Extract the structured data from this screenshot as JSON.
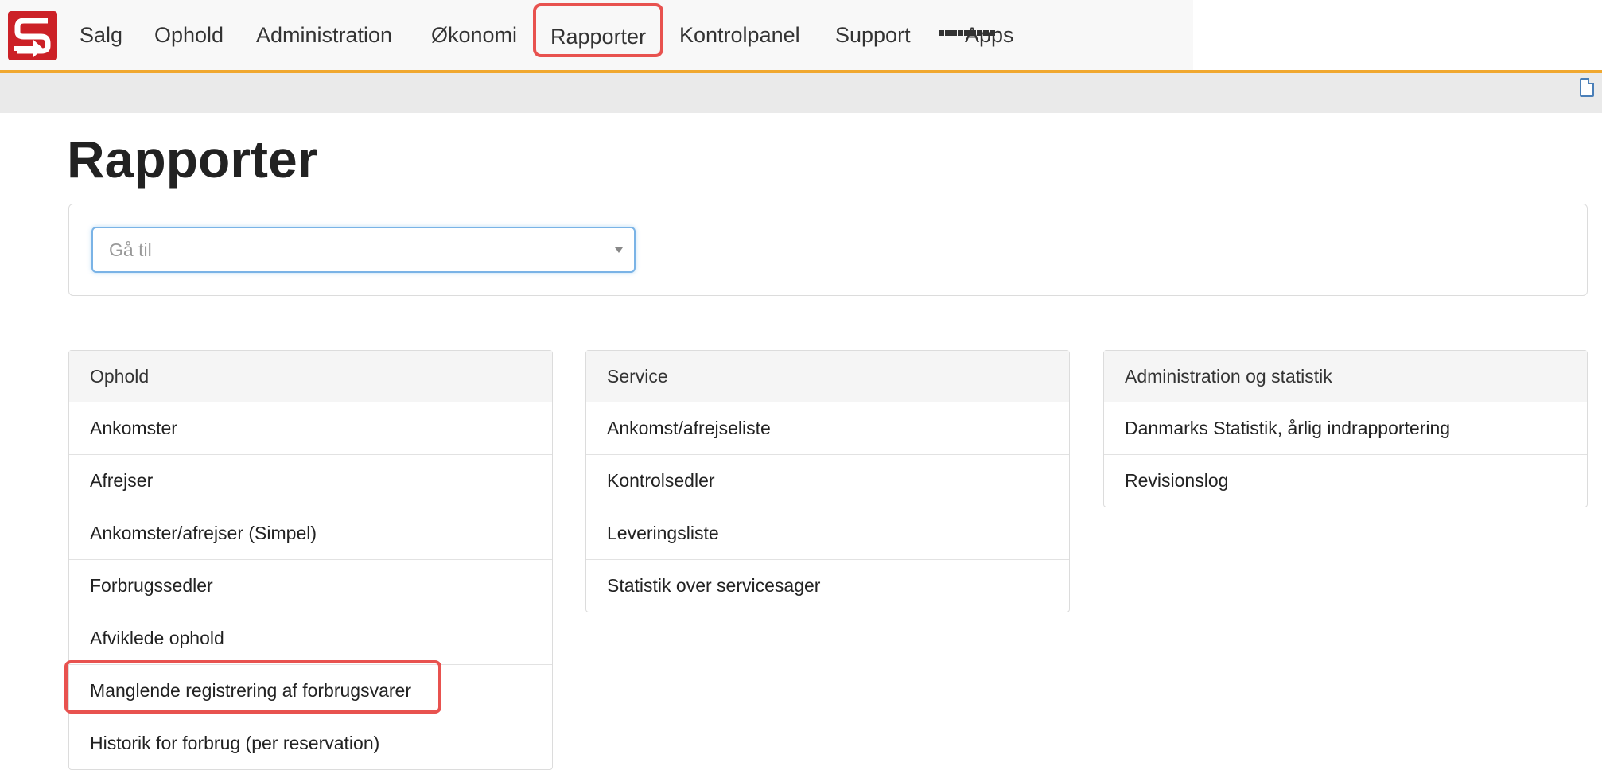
{
  "nav": {
    "logo_icon": "sfd-logo-icon",
    "items": [
      {
        "label": "Salg"
      },
      {
        "label": "Ophold"
      },
      {
        "label": "Administration"
      },
      {
        "label": "Økonomi"
      },
      {
        "label": "Rapporter",
        "active": true
      },
      {
        "label": "Kontrolpanel"
      },
      {
        "label": "Support"
      },
      {
        "label": "Apps",
        "icon": "grid-icon"
      }
    ],
    "accent_color": "#f0a830",
    "highlight_color": "#e8524f"
  },
  "page": {
    "title": "Rapporter"
  },
  "goto": {
    "placeholder": "Gå til"
  },
  "panels": [
    {
      "heading": "Ophold",
      "items": [
        {
          "label": "Ankomster"
        },
        {
          "label": "Afrejser"
        },
        {
          "label": "Ankomster/afrejser (Simpel)"
        },
        {
          "label": "Forbrugssedler"
        },
        {
          "label": "Afviklede ophold"
        },
        {
          "label": "Manglende registrering af forbrugsvarer",
          "highlighted": true
        },
        {
          "label": "Historik for forbrug (per reservation)"
        }
      ]
    },
    {
      "heading": "Service",
      "items": [
        {
          "label": "Ankomst/afrejseliste"
        },
        {
          "label": "Kontrolsedler"
        },
        {
          "label": "Leveringsliste"
        },
        {
          "label": "Statistik over servicesager"
        }
      ]
    },
    {
      "heading": "Administration og statistik",
      "items": [
        {
          "label": "Danmarks Statistik, årlig indrapportering"
        },
        {
          "label": "Revisionslog"
        }
      ]
    }
  ]
}
